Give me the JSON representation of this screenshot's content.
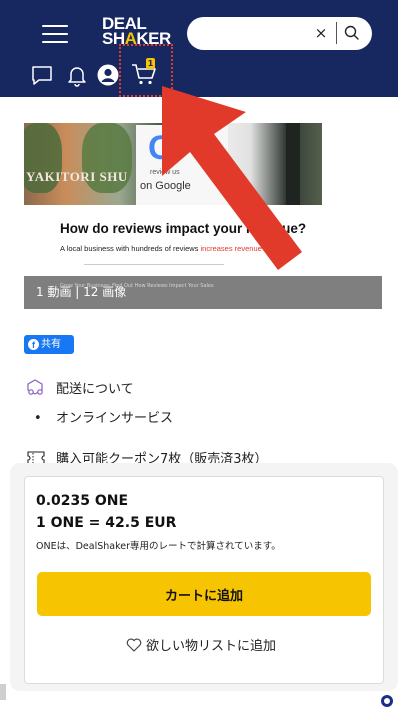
{
  "header": {
    "logo_line1": "DEAL",
    "logo_line2_a": "SH",
    "logo_line2_b": "A",
    "logo_line2_c": "KER",
    "search_value": "",
    "clear_glyph": "×",
    "cart_count": "1",
    "accent_color": "#f6c400",
    "bg_color": "#17275f"
  },
  "banner": {
    "photo_text": "YAKITORI SHU",
    "google_logo": "G",
    "google_sub1": "review us",
    "google_sub2": "on Google",
    "title": "How do reviews impact your revenue?",
    "subtitle_prefix": "A local business with hundreds of reviews ",
    "subtitle_highlight": "increases revenue by 18",
    "ghost_text": "Grow Your Business: Find Out How Reviews Impact Your Sales"
  },
  "media": {
    "count_label": "1 動画 | 12 画像"
  },
  "share": {
    "icon_glyph": "f",
    "label": "共有"
  },
  "delivery": {
    "label": "配送について",
    "bullet": "•",
    "service": "オンラインサービス"
  },
  "coupon": {
    "label": "購入可能クーポン7枚（販売済3枚）"
  },
  "purchase": {
    "price": "0.0235 ONE",
    "rate": "1 ONE = 42.5 EUR",
    "rate_note": "ONEは、DealShaker専用のレートで計算されています。",
    "add_to_cart": "カートに追加",
    "wishlist": "欲しい物リストに追加"
  }
}
